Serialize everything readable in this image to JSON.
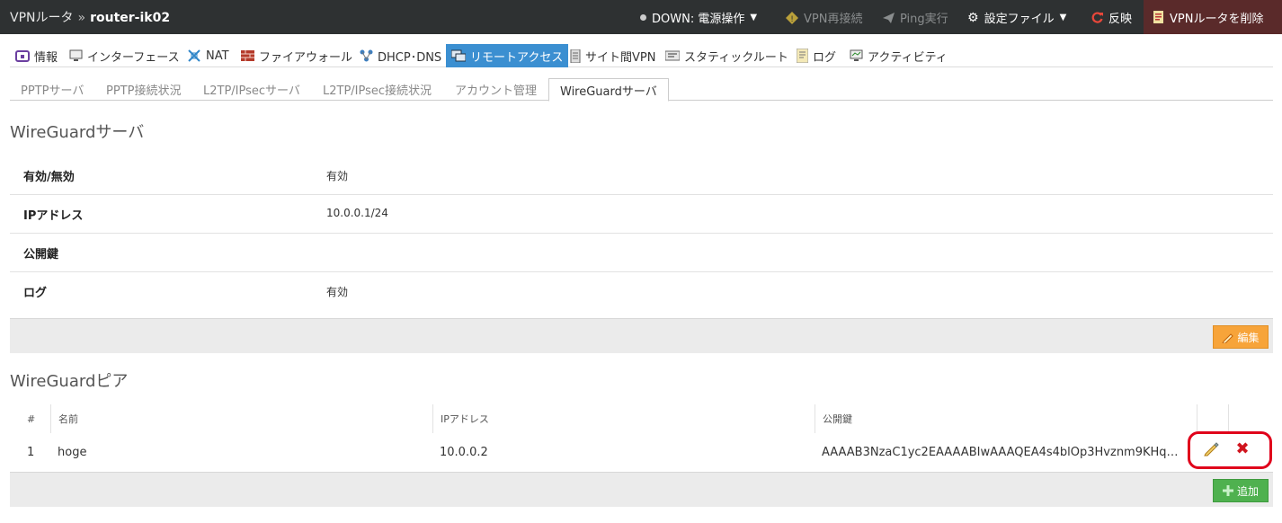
{
  "topbar": {
    "breadcrumb_root": "VPNルータ",
    "breadcrumb_sep": "»",
    "breadcrumb_host": "router-ik02",
    "status_label": "DOWN: 電源操作",
    "vpn_reconnect": "VPN再接続",
    "ping": "Ping実行",
    "config_file": "設定ファイル",
    "apply": "反映",
    "delete_router": "VPNルータを削除"
  },
  "main_tabs": [
    {
      "label": "情報",
      "icon": "info-icon"
    },
    {
      "label": "インターフェース",
      "icon": "monitor-icon"
    },
    {
      "label": "NAT",
      "icon": "nat-icon"
    },
    {
      "label": "ファイアウォール",
      "icon": "firewall-icon"
    },
    {
      "label": "DHCP･DNS",
      "icon": "network-icon"
    },
    {
      "label": "リモートアクセス",
      "icon": "remote-icon",
      "active": true
    },
    {
      "label": "サイト間VPN",
      "icon": "server-icon"
    },
    {
      "label": "スタティックルート",
      "icon": "route-icon"
    },
    {
      "label": "ログ",
      "icon": "log-icon"
    },
    {
      "label": "アクティビティ",
      "icon": "activity-icon"
    }
  ],
  "sub_tabs": [
    {
      "label": "PPTPサーバ"
    },
    {
      "label": "PPTP接続状況"
    },
    {
      "label": "L2TP/IPsecサーバ"
    },
    {
      "label": "L2TP/IPsec接続状況"
    },
    {
      "label": "アカウント管理"
    },
    {
      "label": "WireGuardサーバ",
      "active": true
    }
  ],
  "server_section": {
    "title": "WireGuardサーバ",
    "rows": [
      {
        "label": "有効/無効",
        "value": "有効"
      },
      {
        "label": "IPアドレス",
        "value": "10.0.0.1/24"
      },
      {
        "label": "公開鍵",
        "value": ""
      },
      {
        "label": "ログ",
        "value": "有効"
      }
    ],
    "edit_button": "編集"
  },
  "peer_section": {
    "title": "WireGuardピア",
    "columns": [
      "#",
      "名前",
      "IPアドレス",
      "公開鍵"
    ],
    "rows": [
      {
        "num": "1",
        "name": "hoge",
        "ip": "10.0.0.2",
        "key": "AAAAB3NzaC1yc2EAAAABIwAAAQEA4s4blOp3Hvznm9KHq23…"
      }
    ],
    "add_button": "追加"
  },
  "colors": {
    "topbar_bg": "#2e3132",
    "active_tab": "#3b8fd1",
    "edit_button": "#f7a43a",
    "add_button": "#4fb14f",
    "delete_icon": "#d0141e",
    "highlight_box": "#e0001b"
  }
}
